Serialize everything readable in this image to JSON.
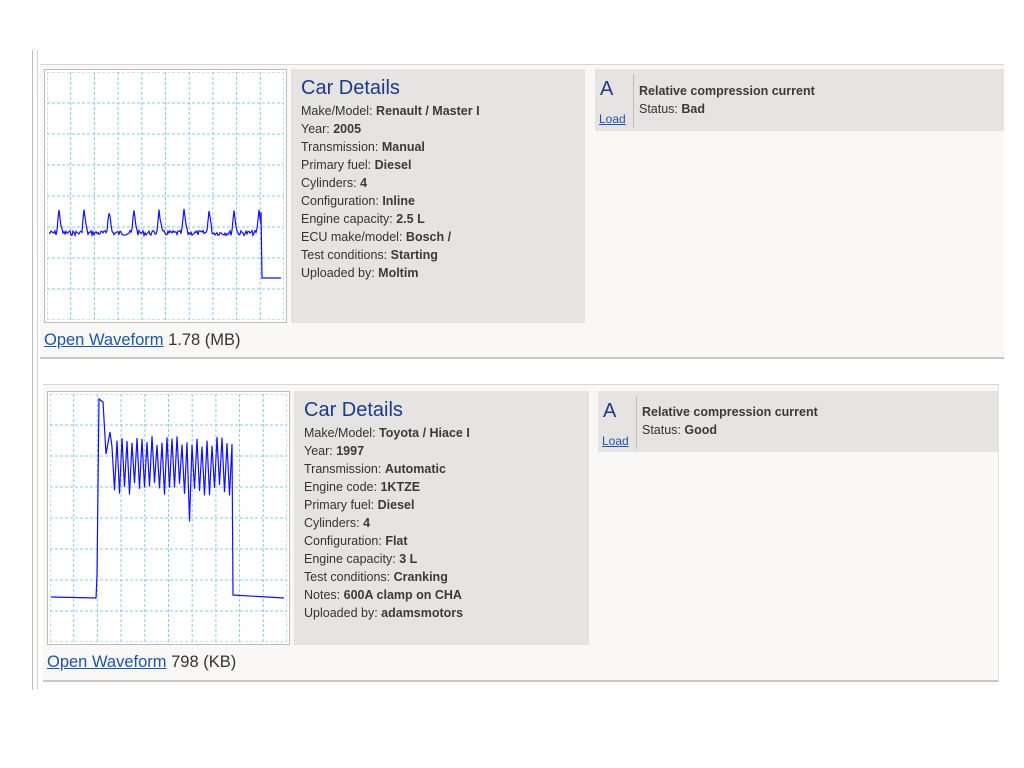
{
  "colors": {
    "trace": "#1010ff",
    "grid": "#8ec8ea",
    "title": "#1c3a8c",
    "link": "#1a55b0"
  },
  "records": [
    {
      "details_title": "Car Details",
      "fields": [
        {
          "label": "Make/Model:",
          "value": "Renault / Master I"
        },
        {
          "label": "Year:",
          "value": "2005"
        },
        {
          "label": "Transmission:",
          "value": "Manual"
        },
        {
          "label": "Primary fuel:",
          "value": "Diesel"
        },
        {
          "label": "Cylinders:",
          "value": "4"
        },
        {
          "label": "Configuration:",
          "value": "Inline"
        },
        {
          "label": "Engine capacity:",
          "value": "2.5 L"
        },
        {
          "label": "ECU make/model:",
          "value": "Bosch /"
        },
        {
          "label": "Test conditions:",
          "value": "Starting"
        },
        {
          "label": "Uploaded by:",
          "value": "Moltim"
        }
      ],
      "panel": {
        "letter": "A",
        "load": "Load",
        "title": "Relative compression current",
        "status_label": "Status:",
        "status_value": "Bad"
      },
      "open_label": "Open Waveform",
      "size": "1.78 (MB)",
      "waveform_icon": "compression-waveform-bad"
    },
    {
      "details_title": "Car Details",
      "fields": [
        {
          "label": "Make/Model:",
          "value": "Toyota / Hiace I"
        },
        {
          "label": "Year:",
          "value": "1997"
        },
        {
          "label": "Transmission:",
          "value": "Automatic"
        },
        {
          "label": "Engine code:",
          "value": "1KTZE"
        },
        {
          "label": "Primary fuel:",
          "value": "Diesel"
        },
        {
          "label": "Cylinders:",
          "value": "4"
        },
        {
          "label": "Configuration:",
          "value": "Flat"
        },
        {
          "label": "Engine capacity:",
          "value": "3 L"
        },
        {
          "label": "Test conditions:",
          "value": "Cranking"
        },
        {
          "label": "Notes:",
          "value": "600A clamp on CHA"
        },
        {
          "label": "Uploaded by:",
          "value": "adamsmotors"
        }
      ],
      "panel": {
        "letter": "A",
        "load": "Load",
        "title": "Relative compression current",
        "status_label": "Status:",
        "status_value": "Good"
      },
      "open_label": "Open Waveform",
      "size": "798 (KB)",
      "waveform_icon": "compression-waveform-good"
    }
  ]
}
